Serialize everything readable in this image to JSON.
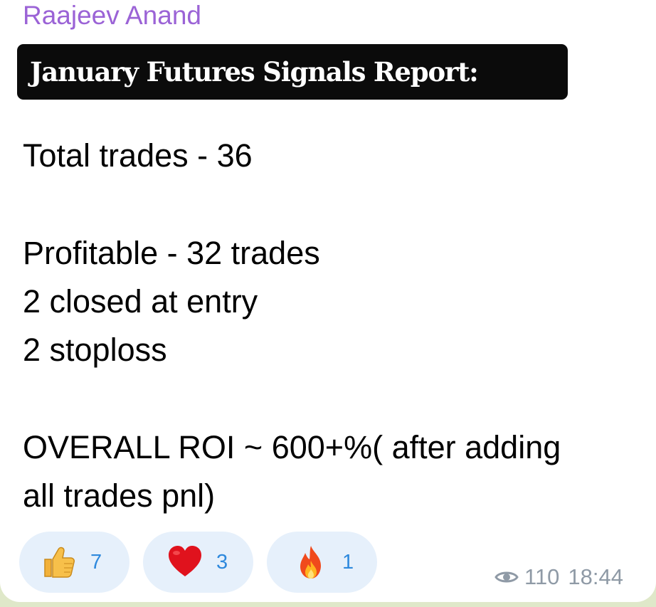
{
  "message": {
    "sender": "Raajeev Anand",
    "headline": "January Futures Signals Report:",
    "lines": [
      "Total trades - 36",
      "Profitable - 32 trades",
      "2 closed at entry",
      "2 stoploss",
      "OVERALL ROI ~ 600+%( after adding",
      "all trades pnl)"
    ],
    "reactions": [
      {
        "icon": "thumbs-up-icon",
        "count": "7"
      },
      {
        "icon": "heart-icon",
        "count": "3"
      },
      {
        "icon": "fire-icon",
        "count": "1"
      }
    ],
    "views": "110",
    "time": "18:44"
  },
  "colors": {
    "sender": "#9b63d6",
    "reaction_bg": "#e6f0fb",
    "reaction_count": "#2e89dd",
    "meta": "#8f9aa6",
    "background": "#dfe8c9"
  }
}
